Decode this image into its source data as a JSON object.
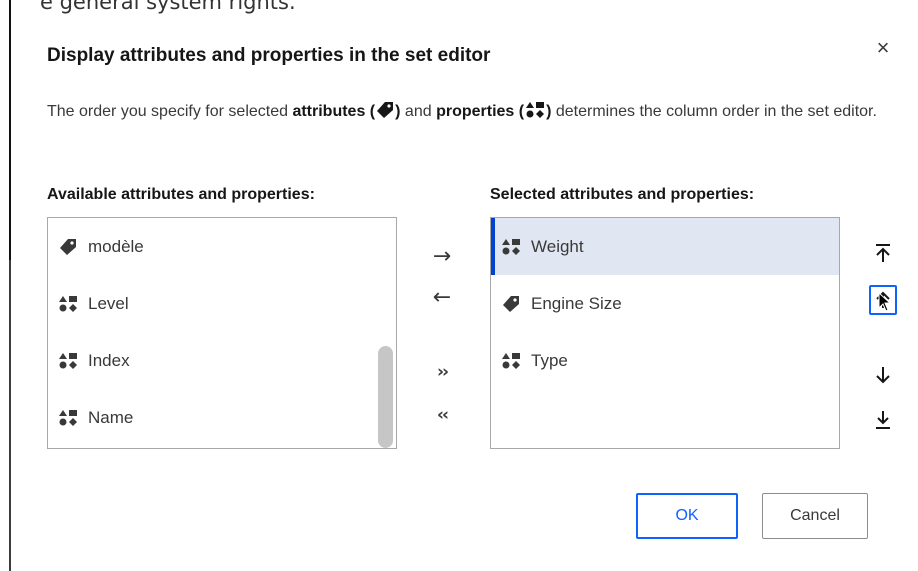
{
  "top_clipped_text": "e general system rights.",
  "dialog": {
    "title": "Display attributes and properties in the set editor",
    "description": {
      "part1": "The order you specify for selected ",
      "attributes_word": "attributes",
      "part2": " and ",
      "properties_word": "properties",
      "part3": " determines the column order in the set editor.",
      "paren_open": " (",
      "paren_close": ")"
    },
    "available_label": "Available attributes and properties:",
    "selected_label": "Selected attributes and properties:",
    "available_items": [
      {
        "label": "modèle",
        "icon": "tag-icon"
      },
      {
        "label": "Level",
        "icon": "property-icon"
      },
      {
        "label": "Index",
        "icon": "property-icon"
      },
      {
        "label": "Name",
        "icon": "property-icon"
      }
    ],
    "selected_items": [
      {
        "label": "Weight",
        "icon": "property-icon",
        "selected": true
      },
      {
        "label": "Engine Size",
        "icon": "tag-icon",
        "selected": false
      },
      {
        "label": "Type",
        "icon": "property-icon",
        "selected": false
      }
    ],
    "transfer": {
      "add": "→",
      "remove": "←",
      "add_all": "››",
      "remove_all": "‹‹"
    },
    "ok_label": "OK",
    "cancel_label": "Cancel",
    "close_glyph": "×"
  },
  "colors": {
    "accent": "#0f62fe",
    "selected_row": "#e0e7f3",
    "selected_bar": "#0043ce"
  }
}
